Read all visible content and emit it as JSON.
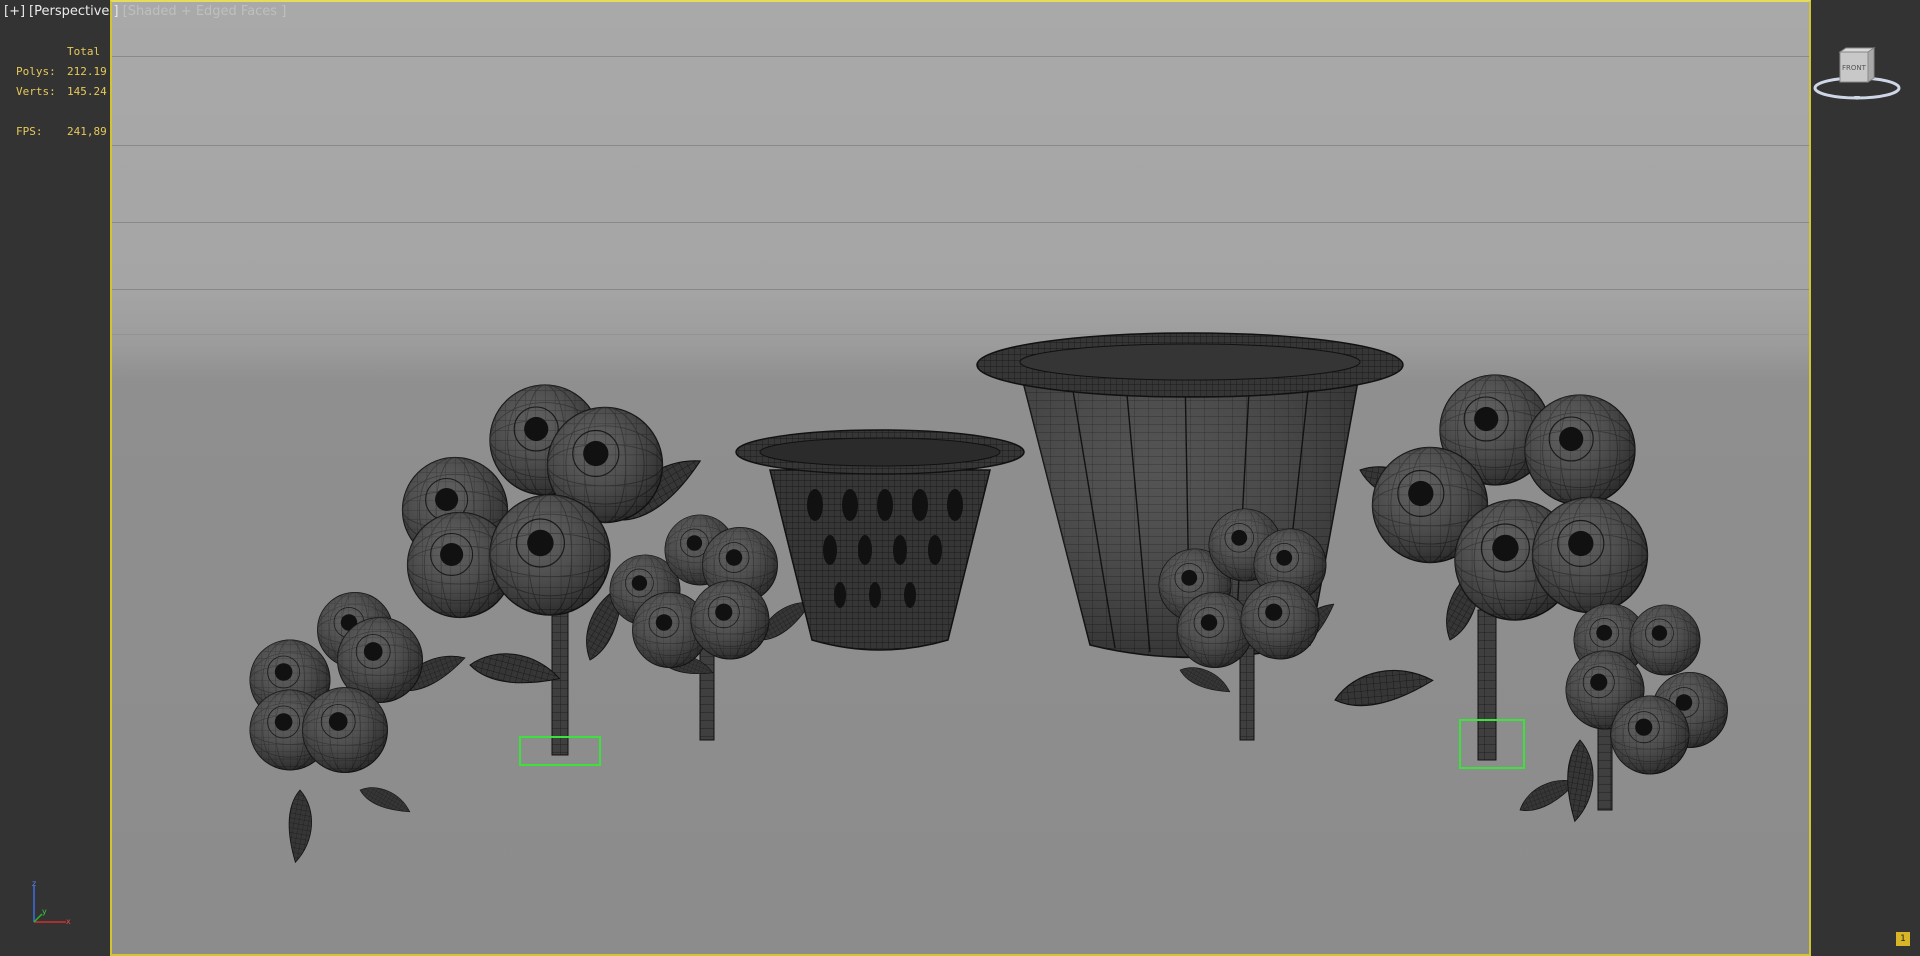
{
  "viewport": {
    "label_plus": "[+]",
    "label_view": "[Perspective ]",
    "label_shading": "[Shaded + Edged Faces ]"
  },
  "stats": {
    "header": "Total",
    "polys_label": "Polys:",
    "polys_value": "212.19",
    "verts_label": "Verts:",
    "verts_value": "145.24",
    "fps_label": "FPS:",
    "fps_value": "241,89"
  },
  "viewcube": {
    "face_label": "FRONT"
  },
  "colors": {
    "viewport_border": "#d2c332",
    "stats_text": "#e7c95a",
    "selection_box": "#3ee03e",
    "mesh_fill": "#3a3a3a",
    "wire": "#1a1a1a"
  },
  "scene_objects": [
    "flower-plant-left-small",
    "flower-plant-left-tall",
    "flower-plant-left-mid",
    "pot-small",
    "pot-large",
    "flower-plant-right-mid",
    "flower-plant-right-tall",
    "flower-plant-right-small"
  ]
}
